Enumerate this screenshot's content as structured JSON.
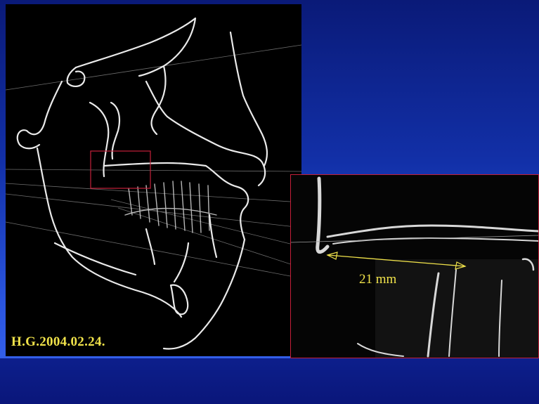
{
  "slide": {
    "date_label": "H.G.2004.02.24.",
    "measurement_label": "21 mm"
  },
  "colors": {
    "background_top": "#0a1a78",
    "background_bottom": "#3a66f0",
    "trace_line": "#e8e8e8",
    "highlight_frame": "#c4203a",
    "label_yellow": "#f0e24a"
  },
  "icons": {
    "measurement_arrow": "double-headed-arrow"
  }
}
